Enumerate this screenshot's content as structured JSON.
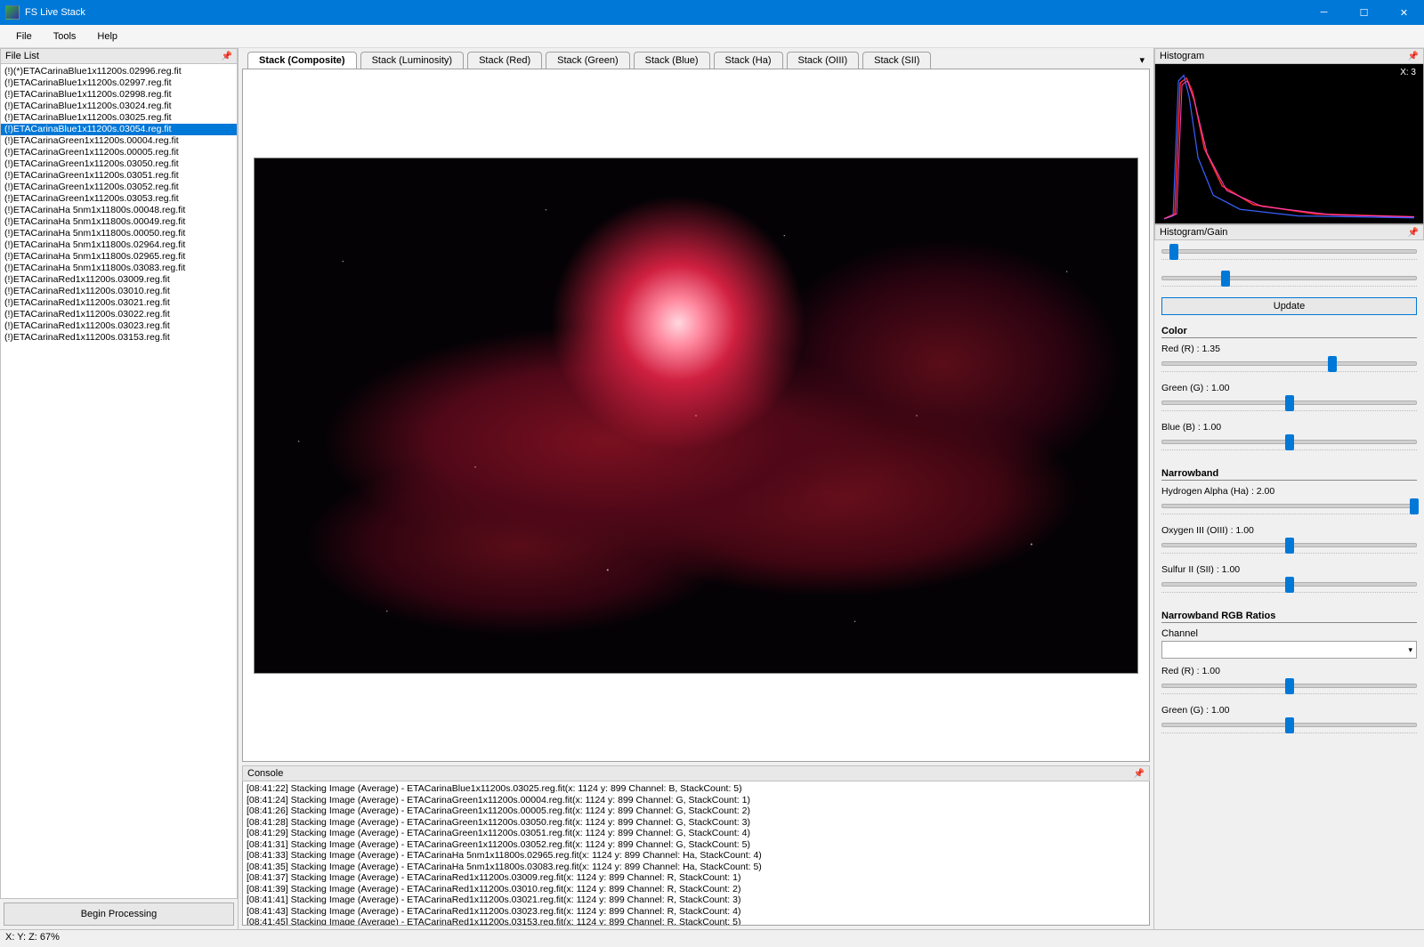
{
  "title": "FS Live Stack",
  "menu": [
    "File",
    "Tools",
    "Help"
  ],
  "fileListTitle": "File List",
  "files": [
    {
      "name": "(!)(*)ETACarinaBlue1x11200s.02996.reg.fit",
      "sel": false
    },
    {
      "name": "(!)ETACarinaBlue1x11200s.02997.reg.fit",
      "sel": false
    },
    {
      "name": "(!)ETACarinaBlue1x11200s.02998.reg.fit",
      "sel": false
    },
    {
      "name": "(!)ETACarinaBlue1x11200s.03024.reg.fit",
      "sel": false
    },
    {
      "name": "(!)ETACarinaBlue1x11200s.03025.reg.fit",
      "sel": false
    },
    {
      "name": "(!)ETACarinaBlue1x11200s.03054.reg.fit",
      "sel": true
    },
    {
      "name": "(!)ETACarinaGreen1x11200s.00004.reg.fit",
      "sel": false
    },
    {
      "name": "(!)ETACarinaGreen1x11200s.00005.reg.fit",
      "sel": false
    },
    {
      "name": "(!)ETACarinaGreen1x11200s.03050.reg.fit",
      "sel": false
    },
    {
      "name": "(!)ETACarinaGreen1x11200s.03051.reg.fit",
      "sel": false
    },
    {
      "name": "(!)ETACarinaGreen1x11200s.03052.reg.fit",
      "sel": false
    },
    {
      "name": "(!)ETACarinaGreen1x11200s.03053.reg.fit",
      "sel": false
    },
    {
      "name": "(!)ETACarinaHa 5nm1x11800s.00048.reg.fit",
      "sel": false
    },
    {
      "name": "(!)ETACarinaHa 5nm1x11800s.00049.reg.fit",
      "sel": false
    },
    {
      "name": "(!)ETACarinaHa 5nm1x11800s.00050.reg.fit",
      "sel": false
    },
    {
      "name": "(!)ETACarinaHa 5nm1x11800s.02964.reg.fit",
      "sel": false
    },
    {
      "name": "(!)ETACarinaHa 5nm1x11800s.02965.reg.fit",
      "sel": false
    },
    {
      "name": "(!)ETACarinaHa 5nm1x11800s.03083.reg.fit",
      "sel": false
    },
    {
      "name": "(!)ETACarinaRed1x11200s.03009.reg.fit",
      "sel": false
    },
    {
      "name": "(!)ETACarinaRed1x11200s.03010.reg.fit",
      "sel": false
    },
    {
      "name": "(!)ETACarinaRed1x11200s.03021.reg.fit",
      "sel": false
    },
    {
      "name": "(!)ETACarinaRed1x11200s.03022.reg.fit",
      "sel": false
    },
    {
      "name": "(!)ETACarinaRed1x11200s.03023.reg.fit",
      "sel": false
    },
    {
      "name": "(!)ETACarinaRed1x11200s.03153.reg.fit",
      "sel": false
    }
  ],
  "beginBtn": "Begin Processing",
  "tabs": [
    "Stack (Composite)",
    "Stack (Luminosity)",
    "Stack (Red)",
    "Stack (Green)",
    "Stack (Blue)",
    "Stack (Ha)",
    "Stack (OIII)",
    "Stack (SII)"
  ],
  "activeTab": 0,
  "consoleTitle": "Console",
  "console": [
    "[08:41:22] Stacking Image (Average) - ETACarinaBlue1x11200s.03025.reg.fit(x: 1124 y: 899 Channel: B, StackCount: 5)",
    "[08:41:24] Stacking Image (Average) - ETACarinaGreen1x11200s.00004.reg.fit(x: 1124 y: 899 Channel: G, StackCount: 1)",
    "[08:41:26] Stacking Image (Average) - ETACarinaGreen1x11200s.00005.reg.fit(x: 1124 y: 899 Channel: G, StackCount: 2)",
    "[08:41:28] Stacking Image (Average) - ETACarinaGreen1x11200s.03050.reg.fit(x: 1124 y: 899 Channel: G, StackCount: 3)",
    "[08:41:29] Stacking Image (Average) - ETACarinaGreen1x11200s.03051.reg.fit(x: 1124 y: 899 Channel: G, StackCount: 4)",
    "[08:41:31] Stacking Image (Average) - ETACarinaGreen1x11200s.03052.reg.fit(x: 1124 y: 899 Channel: G, StackCount: 5)",
    "[08:41:33] Stacking Image (Average) - ETACarinaHa 5nm1x11800s.02965.reg.fit(x: 1124 y: 899 Channel: Ha, StackCount: 4)",
    "[08:41:35] Stacking Image (Average) - ETACarinaHa 5nm1x11800s.03083.reg.fit(x: 1124 y: 899 Channel: Ha, StackCount: 5)",
    "[08:41:37] Stacking Image (Average) - ETACarinaRed1x11200s.03009.reg.fit(x: 1124 y: 899 Channel: R, StackCount: 1)",
    "[08:41:39] Stacking Image (Average) - ETACarinaRed1x11200s.03010.reg.fit(x: 1124 y: 899 Channel: R, StackCount: 2)",
    "[08:41:41] Stacking Image (Average) - ETACarinaRed1x11200s.03021.reg.fit(x: 1124 y: 899 Channel: R, StackCount: 3)",
    "[08:41:43] Stacking Image (Average) - ETACarinaRed1x11200s.03023.reg.fit(x: 1124 y: 899 Channel: R, StackCount: 4)",
    "[08:41:45] Stacking Image (Average) - ETACarinaRed1x11200s.03153.reg.fit(x: 1124 y: 899 Channel: R, StackCount: 5)"
  ],
  "histoTitle": "Histogram",
  "histoX": "X: 3",
  "gainTitle": "Histogram/Gain",
  "updateBtn": "Update",
  "colorHead": "Color",
  "sliders": {
    "red": {
      "label": "Red (R) : 1.35",
      "pos": 67
    },
    "green": {
      "label": "Green (G) : 1.00",
      "pos": 50
    },
    "blue": {
      "label": "Blue (B) : 1.00",
      "pos": 50
    }
  },
  "nbHead": "Narrowband",
  "nbSliders": {
    "ha": {
      "label": "Hydrogen Alpha (Ha) : 2.00",
      "pos": 99
    },
    "oiii": {
      "label": "Oxygen III (OIII) : 1.00",
      "pos": 50
    },
    "sii": {
      "label": "Sulfur II (SII) : 1.00",
      "pos": 50
    }
  },
  "ratioHead": "Narrowband RGB Ratios",
  "channelLabel": "Channel",
  "ratioSliders": {
    "red": {
      "label": "Red (R) : 1.00",
      "pos": 50
    },
    "green": {
      "label": "Green (G) : 1.00",
      "pos": 50
    }
  },
  "status": "X:  Y:  Z: 67%"
}
